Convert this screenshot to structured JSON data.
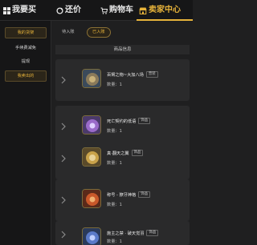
{
  "nav": {
    "buy": "我要买",
    "bargain": "还价",
    "cart": "购物车",
    "seller_center": "卖家中心"
  },
  "sidebar": {
    "items": [
      {
        "label": "我的货架"
      },
      {
        "label": "手续费减免"
      },
      {
        "label": "提现"
      },
      {
        "label": "我卖出的"
      }
    ]
  },
  "filters": {
    "tabs": [
      {
        "label": "待入账"
      },
      {
        "label": "已入账"
      }
    ]
  },
  "table": {
    "header": "商品信息"
  },
  "items": [
    {
      "name": "百臂之物~大加八场",
      "tag": "普装",
      "qty": "数量：1"
    },
    {
      "name": "死亡契约的低语",
      "tag": "饰品",
      "qty": "数量：1"
    },
    {
      "name": "真·翻天之翼",
      "tag": "饰品",
      "qty": "数量：1"
    },
    {
      "name": "称号 - 獠牙神格",
      "tag": "饰品",
      "qty": "数量：1"
    },
    {
      "name": "施主之禁 · 破天觉羽",
      "tag": "饰品",
      "qty": "数量：1"
    }
  ],
  "colors": {
    "accent": "#e7b33a",
    "background": "#1f1f20",
    "card": "#2a2a2b"
  }
}
